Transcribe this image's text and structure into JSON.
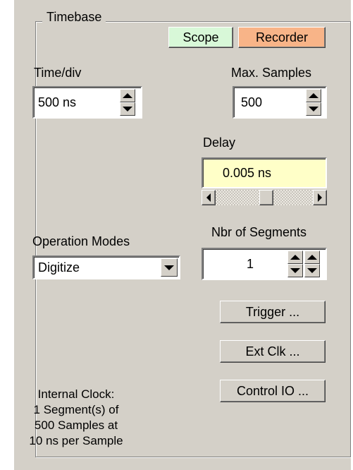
{
  "group": {
    "title": "Timebase"
  },
  "mode_buttons": {
    "scope": {
      "label": "Scope",
      "color": "#d8f8d8"
    },
    "recorder": {
      "label": "Recorder",
      "color": "#f8b488"
    }
  },
  "time_div": {
    "label": "Time/div",
    "value": "500 ns"
  },
  "max_samples": {
    "label": "Max. Samples",
    "value": "500"
  },
  "delay": {
    "label": "Delay",
    "value": "0.005 ns",
    "color": "#ffffc8"
  },
  "operation_modes": {
    "label": "Operation Modes",
    "selected": "Digitize"
  },
  "segments": {
    "label": "Nbr of Segments",
    "value": "1"
  },
  "buttons": {
    "trigger": "Trigger ...",
    "ext_clk": "Ext Clk ...",
    "control_io": "Control IO ..."
  },
  "clock_info": {
    "line1": "Internal Clock:",
    "line2": "1 Segment(s) of",
    "line3": "500 Samples at",
    "line4": "10 ns per Sample"
  }
}
